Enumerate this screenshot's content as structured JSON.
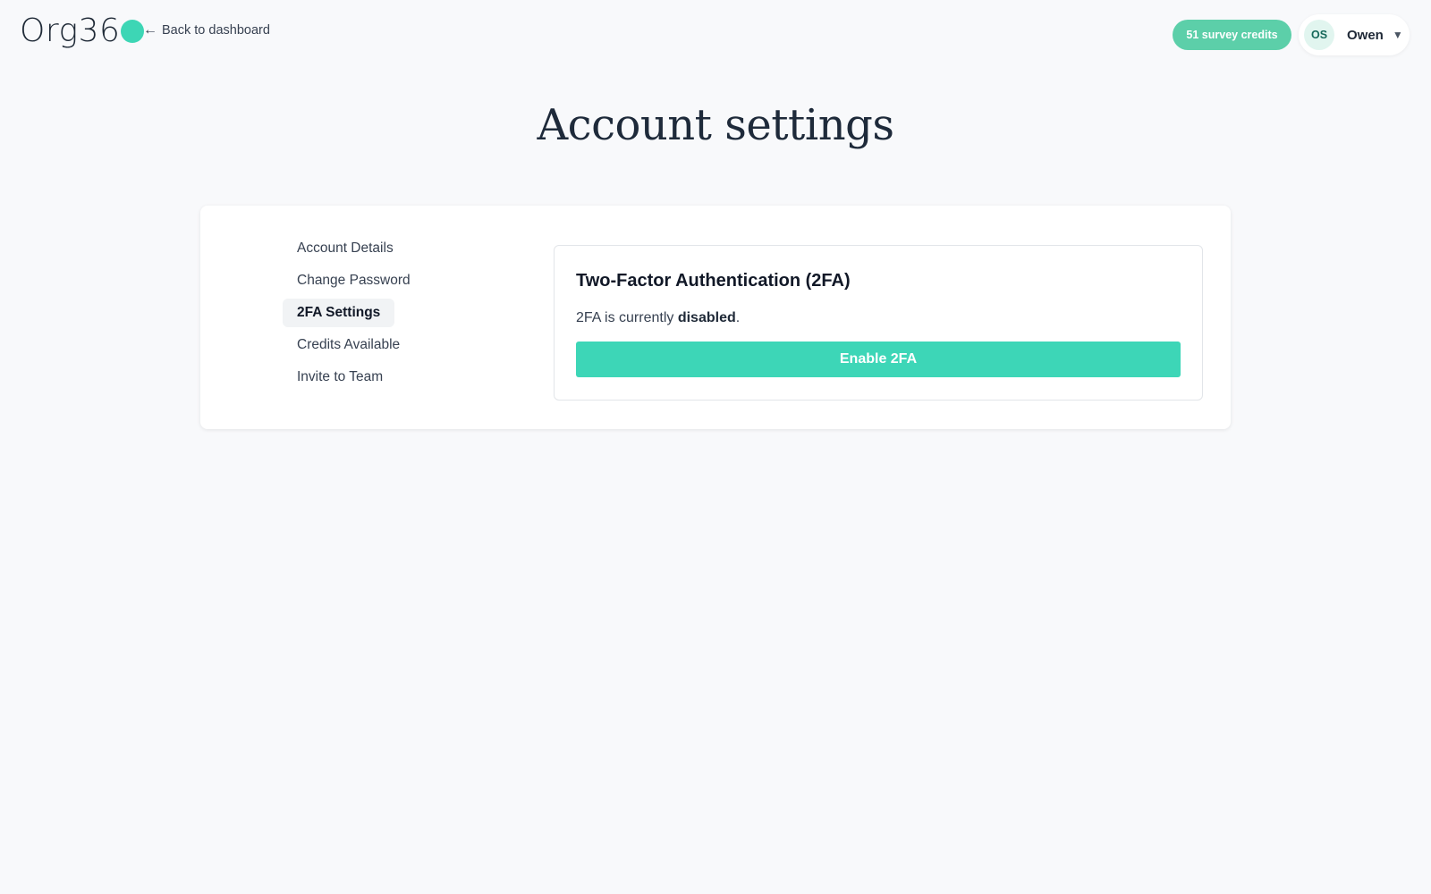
{
  "header": {
    "logo_text": "Org36",
    "back_link_label": "Back to dashboard",
    "credits_label": "51 survey credits",
    "user": {
      "initials": "OS",
      "name": "Owen"
    }
  },
  "page": {
    "title": "Account settings"
  },
  "sidebar": {
    "items": [
      {
        "label": "Account Details",
        "active": false
      },
      {
        "label": "Change Password",
        "active": false
      },
      {
        "label": "2FA Settings",
        "active": true
      },
      {
        "label": "Credits Available",
        "active": false
      },
      {
        "label": "Invite to Team",
        "active": false
      }
    ]
  },
  "twofa_panel": {
    "title": "Two-Factor Authentication (2FA)",
    "status_prefix": "2FA is currently",
    "status_value": "disabled",
    "status_suffix": ".",
    "button_label": "Enable 2FA"
  },
  "colors": {
    "brand_accent": "#3dd6b5",
    "credits_pill": "#5ccfa9",
    "page_background": "#f8f9fb"
  },
  "icons": {
    "back": "arrow-left-icon",
    "user_menu": "chevron-down-icon"
  }
}
